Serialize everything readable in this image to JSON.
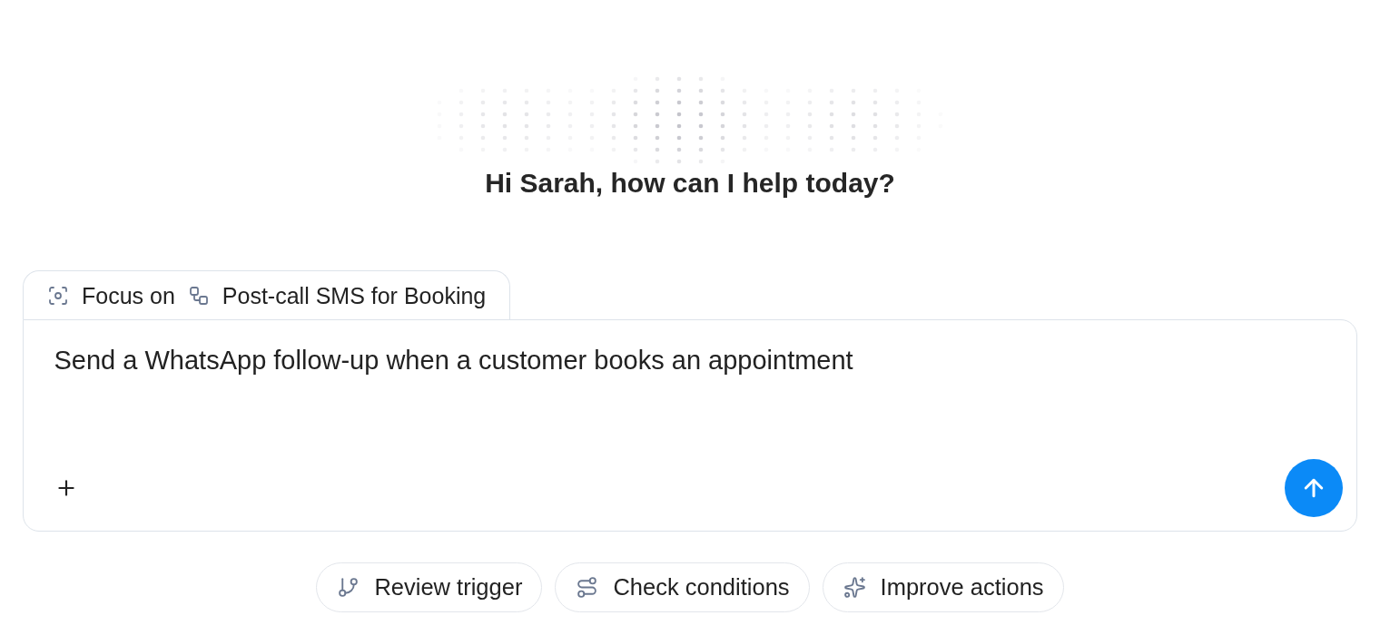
{
  "greeting": "Hi Sarah, how can I help today?",
  "focus": {
    "label": "Focus on",
    "target": "Post-call SMS for Booking"
  },
  "composer": {
    "value": "Send a WhatsApp follow-up when a customer books an appointment"
  },
  "suggestions": [
    {
      "kind": "trigger",
      "label": "Review trigger"
    },
    {
      "kind": "conditions",
      "label": "Check conditions"
    },
    {
      "kind": "actions",
      "label": "Improve actions"
    }
  ]
}
